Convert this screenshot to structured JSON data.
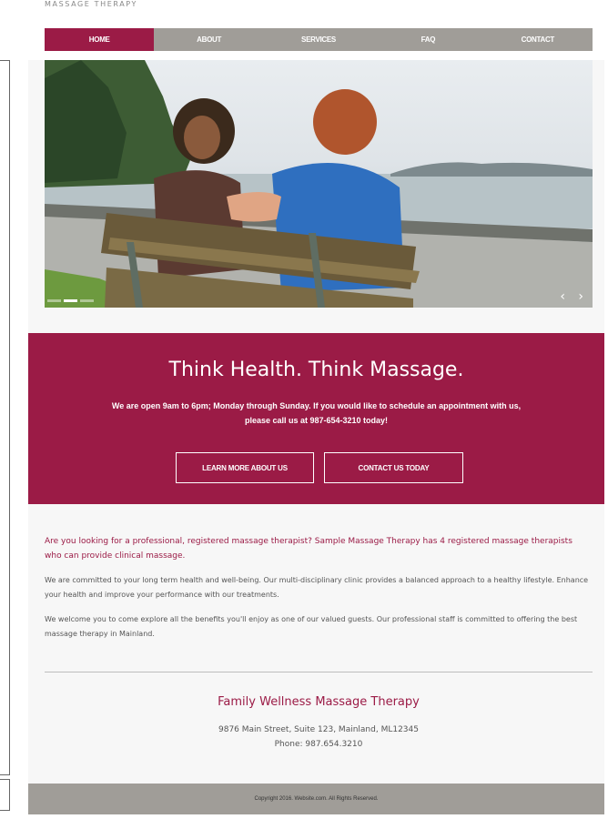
{
  "brand": "MASSAGE THERAPY",
  "nav": {
    "items": [
      {
        "label": "HOME",
        "active": true
      },
      {
        "label": "ABOUT",
        "active": false
      },
      {
        "label": "SERVICES",
        "active": false
      },
      {
        "label": "FAQ",
        "active": false
      },
      {
        "label": "CONTACT",
        "active": false
      }
    ]
  },
  "hero": {
    "slides_total": 3,
    "active_slide": 2,
    "prev_symbol": "‹",
    "next_symbol": "›"
  },
  "band": {
    "title": "Think Health. Think Massage.",
    "text": "We are open 9am to 6pm; Monday through Sunday. If you would like to schedule an appointment with us, please call us at 987-654-3210 today!",
    "button_about": "LEARN MORE ABOUT US",
    "button_contact": "CONTACT US TODAY"
  },
  "content": {
    "intro": "Are you looking for a professional, registered massage therapist? Sample Massage Therapy has 4 registered massage therapists who can provide clinical massage.",
    "paragraph1": "We are committed to your long term health and well-being. Our multi-disciplinary clinic provides a balanced approach to a healthy lifestyle. Enhance your health and improve your performance with our treatments.",
    "paragraph2": "We welcome you to come explore all the benefits you'll enjoy as one of our valued guests. Our professional staff is committed to offering the best massage therapy in Mainland."
  },
  "contact": {
    "name": "Family Wellness Massage Therapy",
    "address": "9876 Main Street, Suite 123, Mainland, ML12345",
    "phone": "Phone: 987.654.3210"
  },
  "footer": {
    "copyright": "Copyright 2016. Website.com. All Rights Reserved."
  },
  "colors": {
    "accent": "#9b1b46",
    "nav_bg": "#a09d98"
  }
}
